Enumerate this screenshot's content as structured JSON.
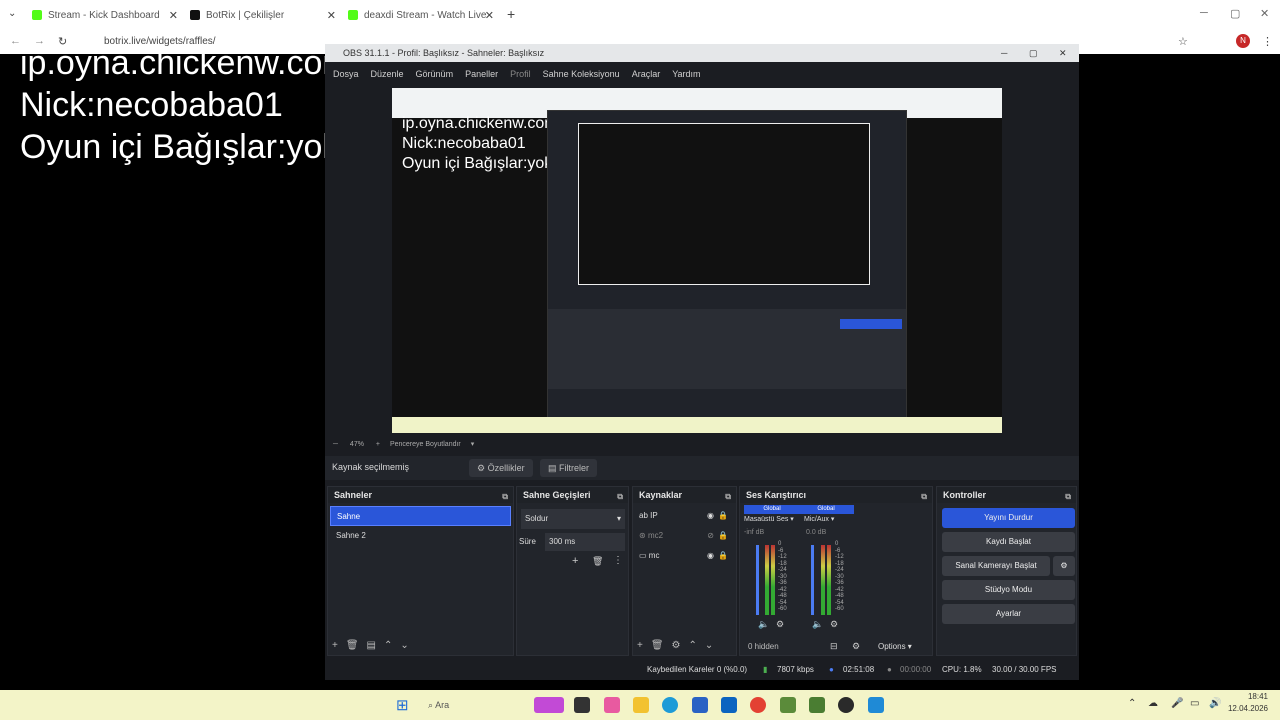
{
  "browser": {
    "tabs": [
      {
        "title": "Stream - Kick Dashboard",
        "color": "#53fc18"
      },
      {
        "title": "BotRix | Çekilişler",
        "color": "#111111"
      },
      {
        "title": "deaxdi Stream - Watch Live",
        "color": "#53fc18"
      }
    ],
    "url": "botrix.live/widgets/raffles/",
    "profile_initial": "N"
  },
  "overlay": {
    "line1": "ip.oyna.chickenw.com",
    "line2": "Nick:necobaba01",
    "line3": "Oyun içi Bağışlar:yok"
  },
  "obs": {
    "title": "OBS 31.1.1 - Profil: Başlıksız - Sahneler: Başlıksız",
    "menu": [
      "Dosya",
      "Düzenle",
      "Görünüm",
      "Paneller",
      "Profil",
      "Sahne Koleksiyonu",
      "Araçlar",
      "Yardım"
    ],
    "zoom": "47%",
    "zoom_mode": "Pencereye Boyutlandır",
    "no_source": "Kaynak seçilmemiş",
    "properties": "Özellikler",
    "filters": "Filtreler",
    "scenes": {
      "title": "Sahneler",
      "items": [
        "Sahne",
        "Sahne 2"
      ]
    },
    "transitions": {
      "title": "Sahne Geçişleri",
      "type": "Soldur",
      "duration_label": "Süre",
      "duration": "300 ms"
    },
    "sources": {
      "title": "Kaynaklar",
      "items": [
        "IP",
        "mc2",
        "mc"
      ],
      "hidden": "0 hidden"
    },
    "mixer": {
      "title": "Ses Karıştırıcı",
      "channels": [
        {
          "tag": "Global",
          "name": "Masaüstü Ses",
          "db": "-inf dB"
        },
        {
          "tag": "Global",
          "name": "Mic/Aux",
          "db": "0.0 dB"
        }
      ],
      "scale": [
        "0",
        "-6",
        "-12",
        "-18",
        "-24",
        "-30",
        "-36",
        "-42",
        "-48",
        "-54",
        "-60"
      ],
      "options": "Options"
    },
    "controls": {
      "title": "Kontroller",
      "stop_stream": "Yayını Durdur",
      "start_record": "Kaydı Başlat",
      "virtual_cam": "Sanal Kamerayı Başlat",
      "studio": "Stüdyo Modu",
      "settings": "Ayarlar"
    },
    "status": {
      "dropped": "Kaybedilen Kareler 0 (%0.0)",
      "bitrate": "7807 kbps",
      "stream_time": "02:51:08",
      "rec_time": "00:00:00",
      "cpu": "CPU: 1.8%",
      "fps": "30.00 / 30.00 FPS"
    }
  },
  "taskbar": {
    "search": "Ara",
    "time": "18:41",
    "date": "12.04.2026"
  }
}
